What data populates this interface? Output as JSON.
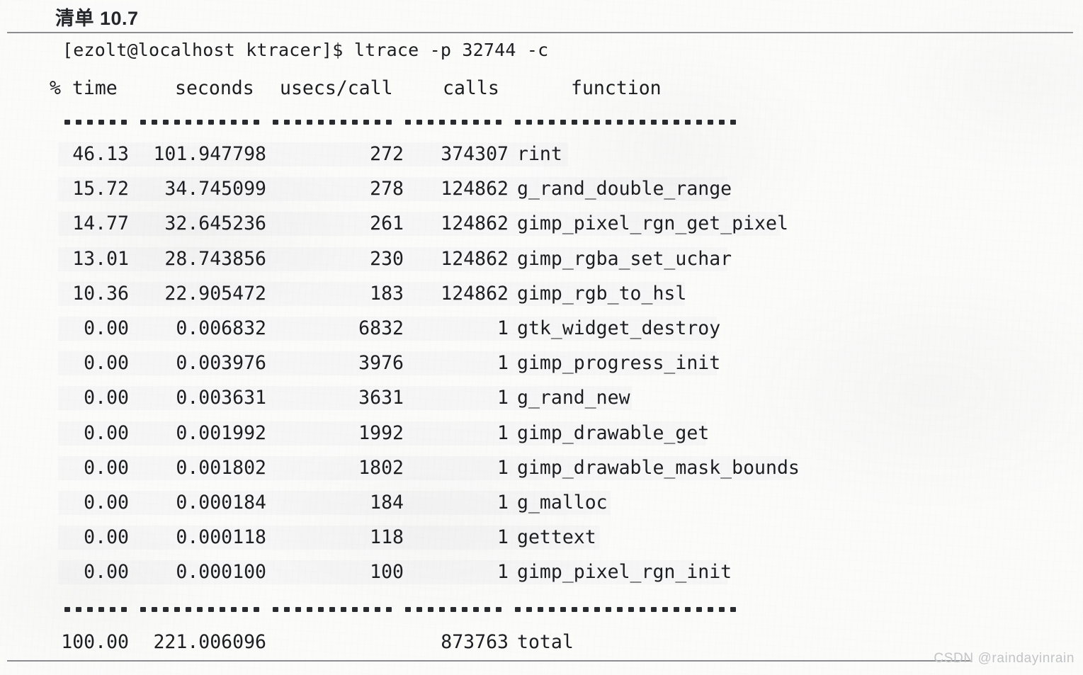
{
  "caption": "清单 10.7",
  "command_line": {
    "prompt": "[ezolt@localhost ktracer]$",
    "command": "ltrace -p 32744 -c",
    "full": "[ezolt@localhost ktracer]$ ltrace -p 32744 -c"
  },
  "table": {
    "headers": {
      "pct_time": "% time",
      "seconds": "seconds",
      "usecs_per_call": "usecs/call",
      "calls": "calls",
      "function": "function"
    },
    "separator_top": "------ ----------- ----------- --------- --------------------",
    "separator_bottom": "------ ----------- ----------- --------- --------------------",
    "separator_groups": [
      6,
      11,
      11,
      9,
      20
    ],
    "rows": [
      {
        "pct_time": "46.13",
        "seconds": "101.947798",
        "usecs_per_call": "272",
        "calls": "374307",
        "function": "rint"
      },
      {
        "pct_time": "15.72",
        "seconds": "34.745099",
        "usecs_per_call": "278",
        "calls": "124862",
        "function": "g_rand_double_range"
      },
      {
        "pct_time": "14.77",
        "seconds": "32.645236",
        "usecs_per_call": "261",
        "calls": "124862",
        "function": "gimp_pixel_rgn_get_pixel"
      },
      {
        "pct_time": "13.01",
        "seconds": "28.743856",
        "usecs_per_call": "230",
        "calls": "124862",
        "function": "gimp_rgba_set_uchar"
      },
      {
        "pct_time": "10.36",
        "seconds": "22.905472",
        "usecs_per_call": "183",
        "calls": "124862",
        "function": "gimp_rgb_to_hsl"
      },
      {
        "pct_time": "0.00",
        "seconds": "0.006832",
        "usecs_per_call": "6832",
        "calls": "1",
        "function": "gtk_widget_destroy"
      },
      {
        "pct_time": "0.00",
        "seconds": "0.003976",
        "usecs_per_call": "3976",
        "calls": "1",
        "function": "gimp_progress_init"
      },
      {
        "pct_time": "0.00",
        "seconds": "0.003631",
        "usecs_per_call": "3631",
        "calls": "1",
        "function": "g_rand_new"
      },
      {
        "pct_time": "0.00",
        "seconds": "0.001992",
        "usecs_per_call": "1992",
        "calls": "1",
        "function": "gimp_drawable_get"
      },
      {
        "pct_time": "0.00",
        "seconds": "0.001802",
        "usecs_per_call": "1802",
        "calls": "1",
        "function": "gimp_drawable_mask_bounds"
      },
      {
        "pct_time": "0.00",
        "seconds": "0.000184",
        "usecs_per_call": "184",
        "calls": "1",
        "function": "g_malloc"
      },
      {
        "pct_time": "0.00",
        "seconds": "0.000118",
        "usecs_per_call": "118",
        "calls": "1",
        "function": "gettext"
      },
      {
        "pct_time": "0.00",
        "seconds": "0.000100",
        "usecs_per_call": "100",
        "calls": "1",
        "function": "gimp_pixel_rgn_init"
      }
    ],
    "total": {
      "pct_time": "100.00",
      "seconds": "221.006096",
      "usecs_per_call": "",
      "calls": "873763",
      "function": "total"
    }
  },
  "watermark": "CSDN @raindayinrain",
  "colors": {
    "text": "#1d1e22",
    "caption": "#25262a",
    "rule": "#6d6e72",
    "paper": "#fbfbfa",
    "watermark": "#c3c4c8"
  }
}
